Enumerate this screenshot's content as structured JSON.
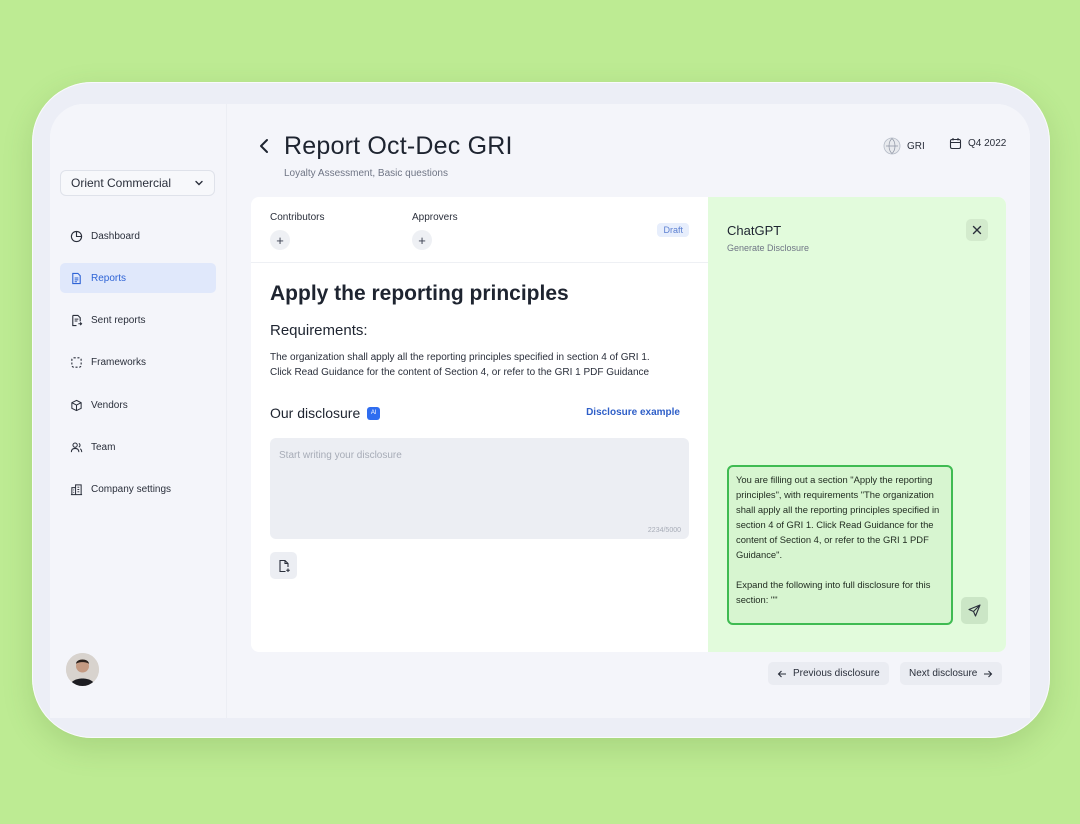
{
  "sidebar": {
    "org_name": "Orient Commercial",
    "items": [
      {
        "label": "Dashboard",
        "icon": "pie-chart-icon"
      },
      {
        "label": "Reports",
        "icon": "document-icon",
        "active": true
      },
      {
        "label": "Sent reports",
        "icon": "sent-document-icon"
      },
      {
        "label": "Frameworks",
        "icon": "dashed-square-icon"
      },
      {
        "label": "Vendors",
        "icon": "box-icon"
      },
      {
        "label": "Team",
        "icon": "users-icon"
      },
      {
        "label": "Company settings",
        "icon": "building-icon"
      }
    ]
  },
  "header": {
    "title": "Report Oct-Dec GRI",
    "subtitle": "Loyalty Assessment, Basic questions",
    "framework": "GRI",
    "period": "Q4 2022"
  },
  "report": {
    "contributors_label": "Contributors",
    "approvers_label": "Approvers",
    "status": "Draft",
    "section_title": "Apply the reporting principles",
    "requirements_title": "Requirements:",
    "requirements_line1": "The organization shall apply all the reporting principles specified in section 4 of GRI 1.",
    "requirements_line2": "Click Read Guidance for the content of Section 4, or refer to the GRI 1 PDF Guidance",
    "disclosure_title": "Our disclosure",
    "ai_chip": "AI",
    "disclosure_example": "Disclosure example",
    "disclosure_placeholder": "Start writing your disclosure",
    "char_counter": "2234/5000"
  },
  "chatgpt": {
    "title": "ChatGPT",
    "subtitle": "Generate Disclosure",
    "prompt_para1": "You are filling out a section \"Apply the reporting principles\", with requirements \"The organization shall apply all the reporting principles specified in section 4 of GRI 1. Click Read Guidance for the content of Section 4, or refer to the GRI 1 PDF Guidance\".",
    "prompt_para2": "Expand the following into full disclosure for this section: \"\""
  },
  "footer": {
    "prev_label": "Previous disclosure",
    "next_label": "Next disclosure"
  },
  "colors": {
    "background": "#bdeb93",
    "accent": "#2f64d6",
    "chat_panel": "#e2fbdc",
    "prompt_border": "#3fbb52"
  }
}
